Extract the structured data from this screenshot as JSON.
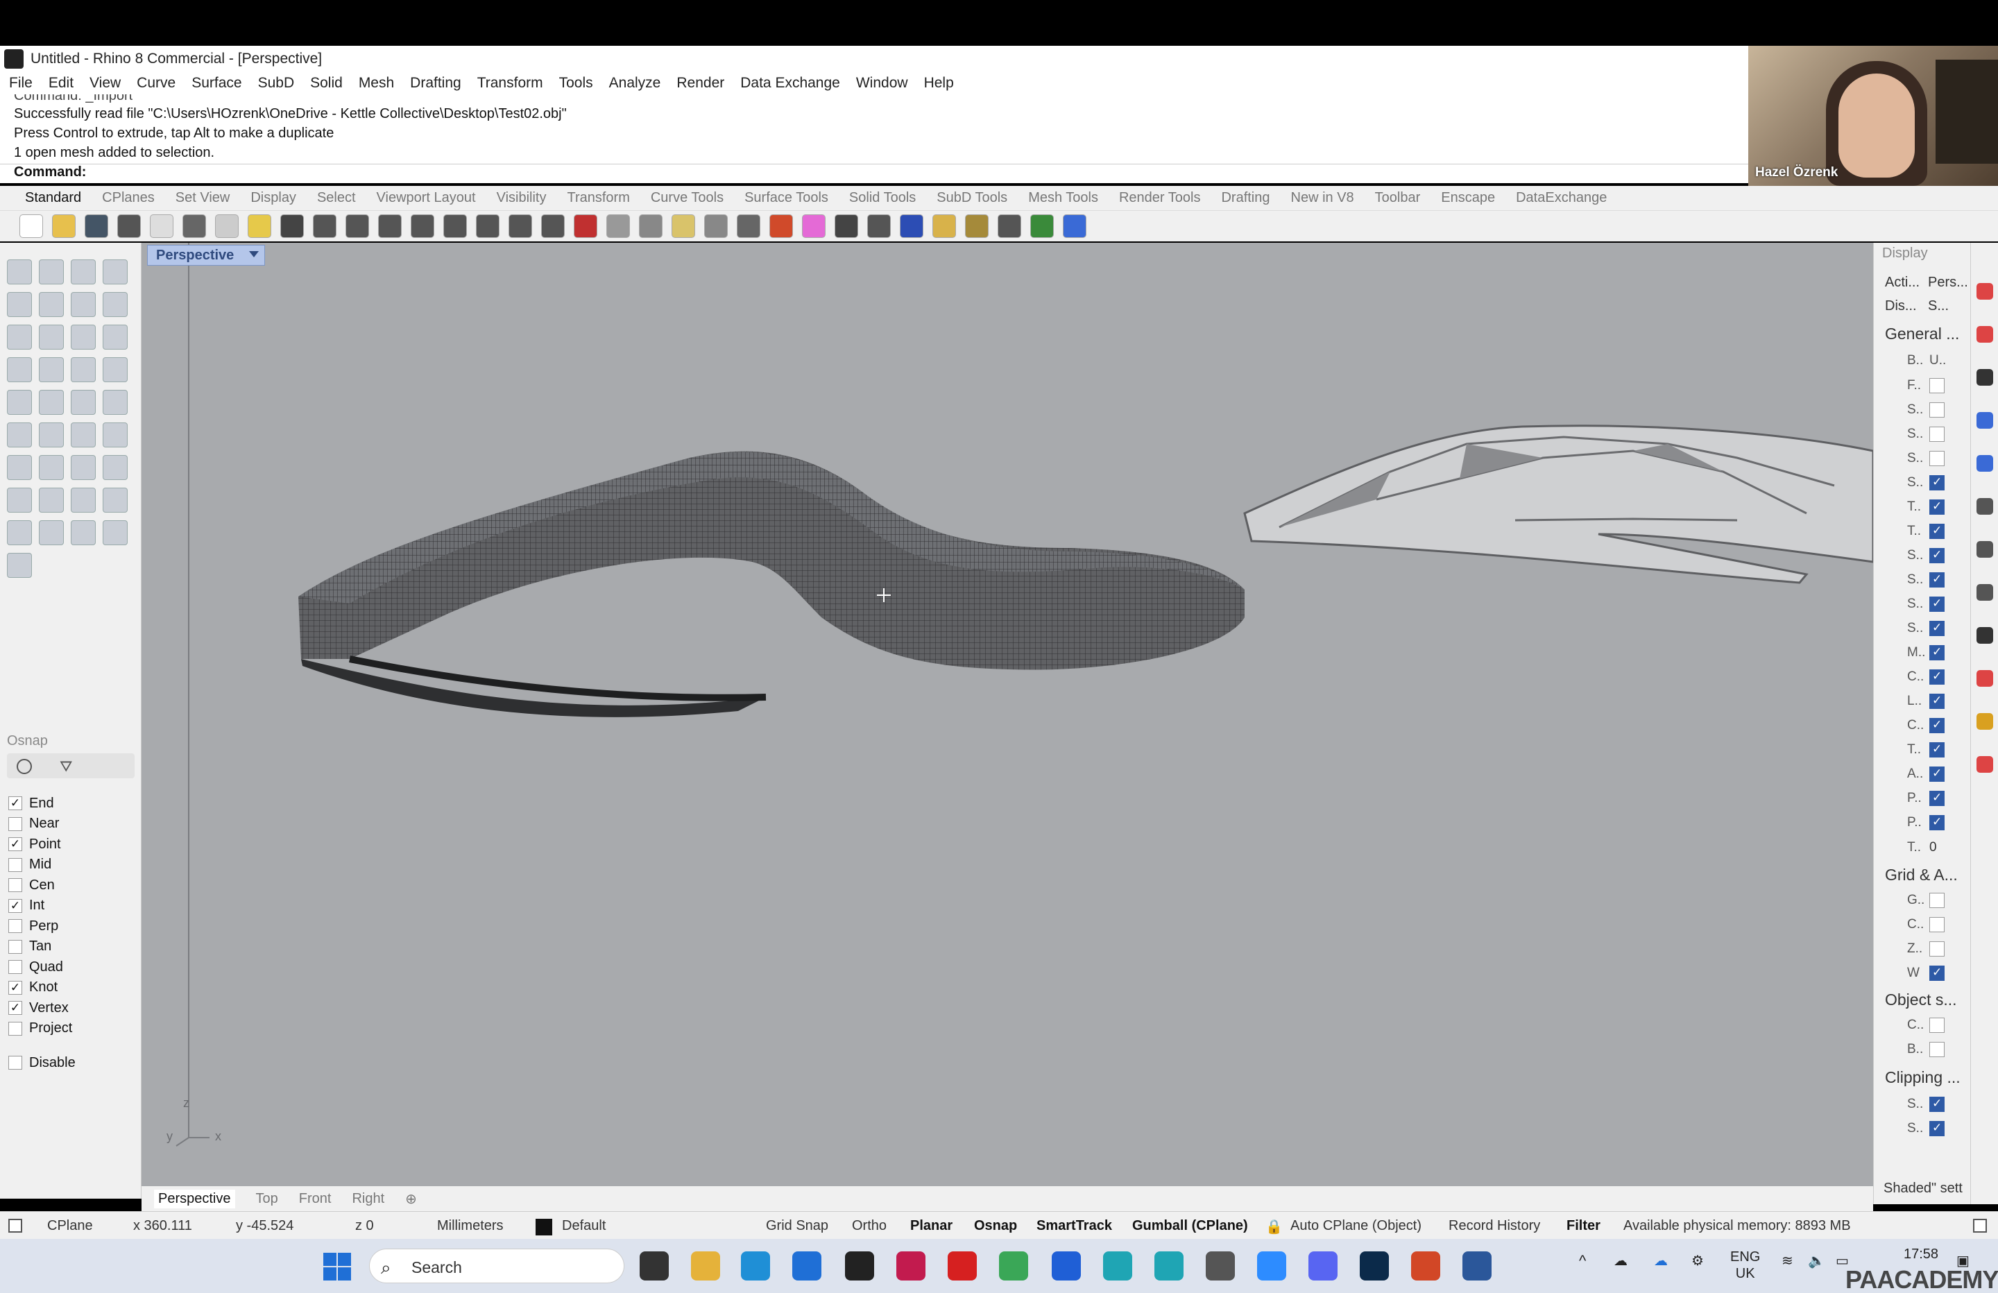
{
  "title_bar": {
    "title": "Untitled - Rhino 8 Commercial - [Perspective]"
  },
  "menu": [
    "File",
    "Edit",
    "View",
    "Curve",
    "Surface",
    "SubD",
    "Solid",
    "Mesh",
    "Drafting",
    "Transform",
    "Tools",
    "Analyze",
    "Render",
    "Data Exchange",
    "Window",
    "Help"
  ],
  "command_history": {
    "cut_line": "Command: _Import",
    "lines": [
      "Successfully read file \"C:\\Users\\HOzrenk\\OneDrive - Kettle Collective\\Desktop\\Test02.obj\"",
      "Press Control to extrude, tap Alt to make a duplicate",
      "1 open mesh added to selection."
    ],
    "prompt": "Command:"
  },
  "webcam": {
    "name": "Hazel Özrenk"
  },
  "toolbar_tabs": [
    "Standard",
    "CPlanes",
    "Set View",
    "Display",
    "Select",
    "Viewport Layout",
    "Visibility",
    "Transform",
    "Curve Tools",
    "Surface Tools",
    "Solid Tools",
    "SubD Tools",
    "Mesh Tools",
    "Render Tools",
    "Drafting",
    "New in V8",
    "Toolbar",
    "Enscape",
    "DataExchange"
  ],
  "toolbar_tab_active": "Standard",
  "viewport": {
    "title": "Perspective",
    "axis_z": "z",
    "axis_y": "y",
    "axis_x": "x"
  },
  "viewport_tabs": [
    "Perspective",
    "Top",
    "Front",
    "Right"
  ],
  "osnap": {
    "header": "Osnap",
    "items": [
      {
        "label": "End",
        "checked": true
      },
      {
        "label": "Near",
        "checked": false
      },
      {
        "label": "Point",
        "checked": true
      },
      {
        "label": "Mid",
        "checked": false
      },
      {
        "label": "Cen",
        "checked": false
      },
      {
        "label": "Int",
        "checked": true
      },
      {
        "label": "Perp",
        "checked": false
      },
      {
        "label": "Tan",
        "checked": false
      },
      {
        "label": "Quad",
        "checked": false
      },
      {
        "label": "Knot",
        "checked": true
      },
      {
        "label": "Vertex",
        "checked": true
      },
      {
        "label": "Project",
        "checked": false
      }
    ],
    "disable": "Disable"
  },
  "display_panel": {
    "header": "Display",
    "active_label": "Acti...",
    "active_value": "Pers...",
    "dis_label": "Dis...",
    "dis_value": "S...",
    "general": "General ...",
    "general_first_key": "B..",
    "general_first_value": "U..",
    "general_rows": [
      {
        "k": "F..",
        "on": false
      },
      {
        "k": "S..",
        "on": false
      },
      {
        "k": "S..",
        "on": false
      },
      {
        "k": "S..",
        "on": false
      },
      {
        "k": "S..",
        "on": true
      },
      {
        "k": "T..",
        "on": true
      },
      {
        "k": "T..",
        "on": true
      },
      {
        "k": "S..",
        "on": true
      },
      {
        "k": "S..",
        "on": true
      },
      {
        "k": "S..",
        "on": true
      },
      {
        "k": "S..",
        "on": true
      },
      {
        "k": "M..",
        "on": true
      },
      {
        "k": "C..",
        "on": true
      },
      {
        "k": "L..",
        "on": true
      },
      {
        "k": "C..",
        "on": true
      },
      {
        "k": "T..",
        "on": true
      },
      {
        "k": "A..",
        "on": true
      },
      {
        "k": "P..",
        "on": true
      },
      {
        "k": "P..",
        "on": true
      }
    ],
    "t_key": "T..",
    "t_value": "0",
    "grid": "Grid & A...",
    "grid_rows": [
      {
        "k": "G..",
        "on": false
      },
      {
        "k": "C..",
        "on": false
      },
      {
        "k": "Z..",
        "on": false
      },
      {
        "k": "W",
        "on": true
      }
    ],
    "objects": "Object s...",
    "object_rows": [
      {
        "k": "C..",
        "on": false
      },
      {
        "k": "B..",
        "on": false
      }
    ],
    "clipping": "Clipping ...",
    "clipping_rows": [
      {
        "k": "S..",
        "on": true
      },
      {
        "k": "S..",
        "on": true
      }
    ],
    "footer": "Shaded\" sett"
  },
  "status_bar": {
    "cplane": "CPlane",
    "x": "x 360.111",
    "y": "y -45.524",
    "z": "z 0",
    "units": "Millimeters",
    "layer": "Default",
    "grid_snap": "Grid Snap",
    "ortho": "Ortho",
    "planar": "Planar",
    "osnap": "Osnap",
    "smarttrack": "SmartTrack",
    "gumball": "Gumball (CPlane)",
    "auto_cplane": "Auto CPlane (Object)",
    "record_history": "Record History",
    "filter": "Filter",
    "memory": "Available physical memory: 8893 MB"
  },
  "taskbar": {
    "search_placeholder": "Search",
    "lang_top": "ENG",
    "lang_bottom": "UK",
    "time": "17:58",
    "watermark": "PAACADEMY"
  },
  "colors": {
    "viewport_bg": "#a8aaad",
    "checkbox_blue": "#2e5aa6",
    "viewport_title_bg": "#b4c6ea"
  }
}
